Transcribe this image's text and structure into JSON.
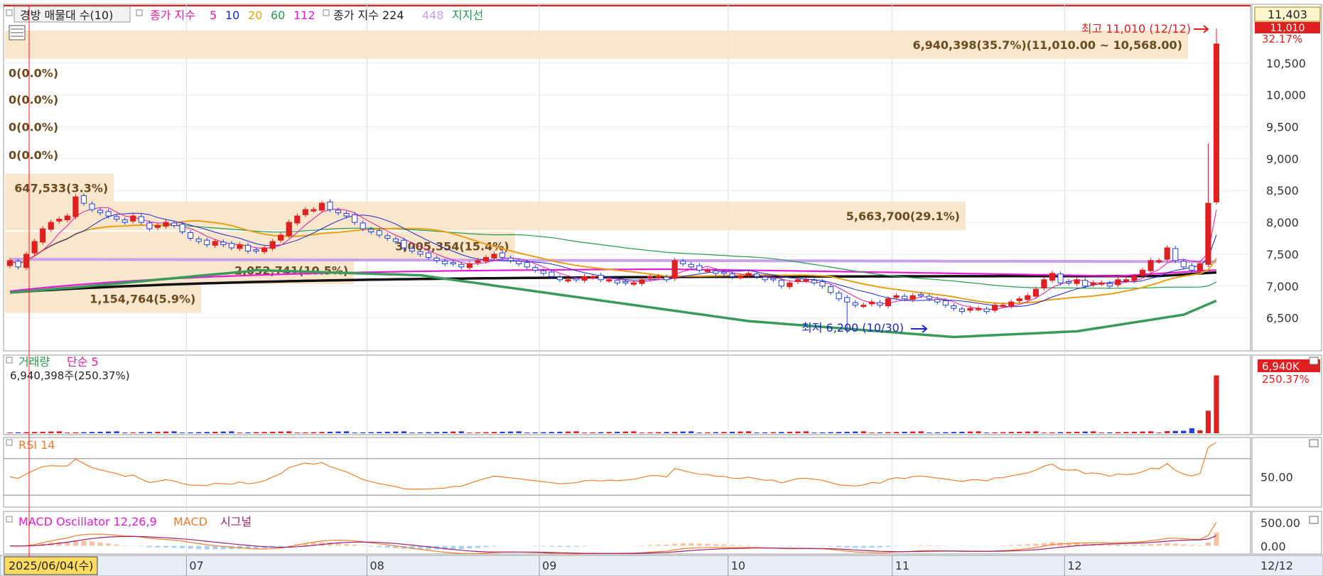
{
  "price_pane": {
    "title": "경방 매물대 수(10)",
    "ma_label": "종가 지수",
    "ma_periods": [
      {
        "label": "5",
        "color": "#e81aa8"
      },
      {
        "label": "10",
        "color": "#1a28c8"
      },
      {
        "label": "20",
        "color": "#e8a018"
      },
      {
        "label": "60",
        "color": "#239b4a"
      },
      {
        "label": "112",
        "color": "#e81ad8"
      }
    ],
    "ma2_label": "종가 지수 224",
    "ma2_extra": "448",
    "support_label": "지지선",
    "high_label": "최고 11,010 (12/12)",
    "low_label": "최저 6,200 (10/30)",
    "current_price": "11,403",
    "current_change_price": "11,010",
    "current_change_pct": "32.17%",
    "y_ticks": [
      "10,500",
      "10,000",
      "9,500",
      "9,000",
      "8,500",
      "8,000",
      "7,500",
      "7,000",
      "6,500"
    ]
  },
  "volume_profile": [
    {
      "label": "6,940,398(35.7%)(11,010.00 ~ 10,568.00)",
      "level": 10790,
      "frac": 1.0
    },
    {
      "label": "0(0.0%)",
      "level": 10350,
      "frac": 0.0
    },
    {
      "label": "0(0.0%)",
      "level": 9930,
      "frac": 0.0
    },
    {
      "label": "0(0.0%)",
      "level": 9500,
      "frac": 0.0
    },
    {
      "label": "0(0.0%)",
      "level": 9060,
      "frac": 0.0
    },
    {
      "label": "647,533(3.3%)",
      "level": 8540,
      "frac": 0.092
    },
    {
      "label": "5,663,700(29.1%)",
      "level": 8100,
      "frac": 0.812
    },
    {
      "label": "3,005,354(15.4%)",
      "level": 7630,
      "frac": 0.431
    },
    {
      "label": "2,052,741(10.5%)",
      "level": 7250,
      "frac": 0.295
    },
    {
      "label": "1,154,764(5.9%)",
      "level": 6800,
      "frac": 0.166
    }
  ],
  "volume_pane": {
    "title": "거래량",
    "ma_label": "단순 5",
    "current_text": "6,940,398주(250.37%)",
    "current_value": "6,940K",
    "current_pct": "250.37%"
  },
  "rsi_pane": {
    "title": "RSI 14",
    "tick": "50.00"
  },
  "macd_pane": {
    "title": "MACD Oscillator 12,26,9",
    "macd_label": "MACD",
    "signal_label": "시그널",
    "ticks": [
      "500.00",
      "0.00"
    ]
  },
  "x_axis": {
    "cursor_date": "2025/06/04(수)",
    "months": [
      "07",
      "08",
      "09",
      "10",
      "11",
      "12"
    ],
    "end_label": "12/12"
  },
  "chart_data": {
    "type": "candlestick",
    "series_start": "2025-06-02",
    "closes": [
      7400,
      7300,
      7500,
      7700,
      7900,
      8000,
      8050,
      8100,
      8400,
      8300,
      8200,
      8150,
      8100,
      8050,
      8000,
      8100,
      8000,
      7900,
      7950,
      8000,
      7950,
      7850,
      7750,
      7700,
      7650,
      7700,
      7650,
      7600,
      7650,
      7550,
      7550,
      7600,
      7700,
      7800,
      8000,
      8100,
      8200,
      8200,
      8300,
      8200,
      8150,
      8100,
      8000,
      7900,
      7850,
      7800,
      7750,
      7700,
      7600,
      7550,
      7500,
      7450,
      7400,
      7350,
      7350,
      7300,
      7350,
      7400,
      7450,
      7500,
      7450,
      7400,
      7350,
      7300,
      7250,
      7200,
      7150,
      7100,
      7100,
      7100,
      7150,
      7150,
      7100,
      7100,
      7050,
      7050,
      7050,
      7100,
      7150,
      7150,
      7100,
      7400,
      7350,
      7300,
      7250,
      7250,
      7200,
      7200,
      7150,
      7150,
      7200,
      7150,
      7100,
      7100,
      7000,
      7050,
      7100,
      7100,
      7050,
      7000,
      6900,
      6800,
      6750,
      6700,
      6700,
      6750,
      6700,
      6800,
      6850,
      6800,
      6850,
      6850,
      6800,
      6750,
      6700,
      6650,
      6600,
      6650,
      6650,
      6600,
      6700,
      6700,
      6750,
      6800,
      6850,
      6950,
      7100,
      7200,
      7050,
      7050,
      7100,
      7000,
      7050,
      7050,
      7000,
      7100,
      7100,
      7150,
      7250,
      7400,
      7400,
      7600,
      7400,
      7300,
      7250,
      7350,
      8300,
      10800
    ],
    "volume_scale_max": 7500000,
    "rsi_range": [
      20,
      90
    ],
    "macd_range": [
      -100,
      600
    ]
  }
}
